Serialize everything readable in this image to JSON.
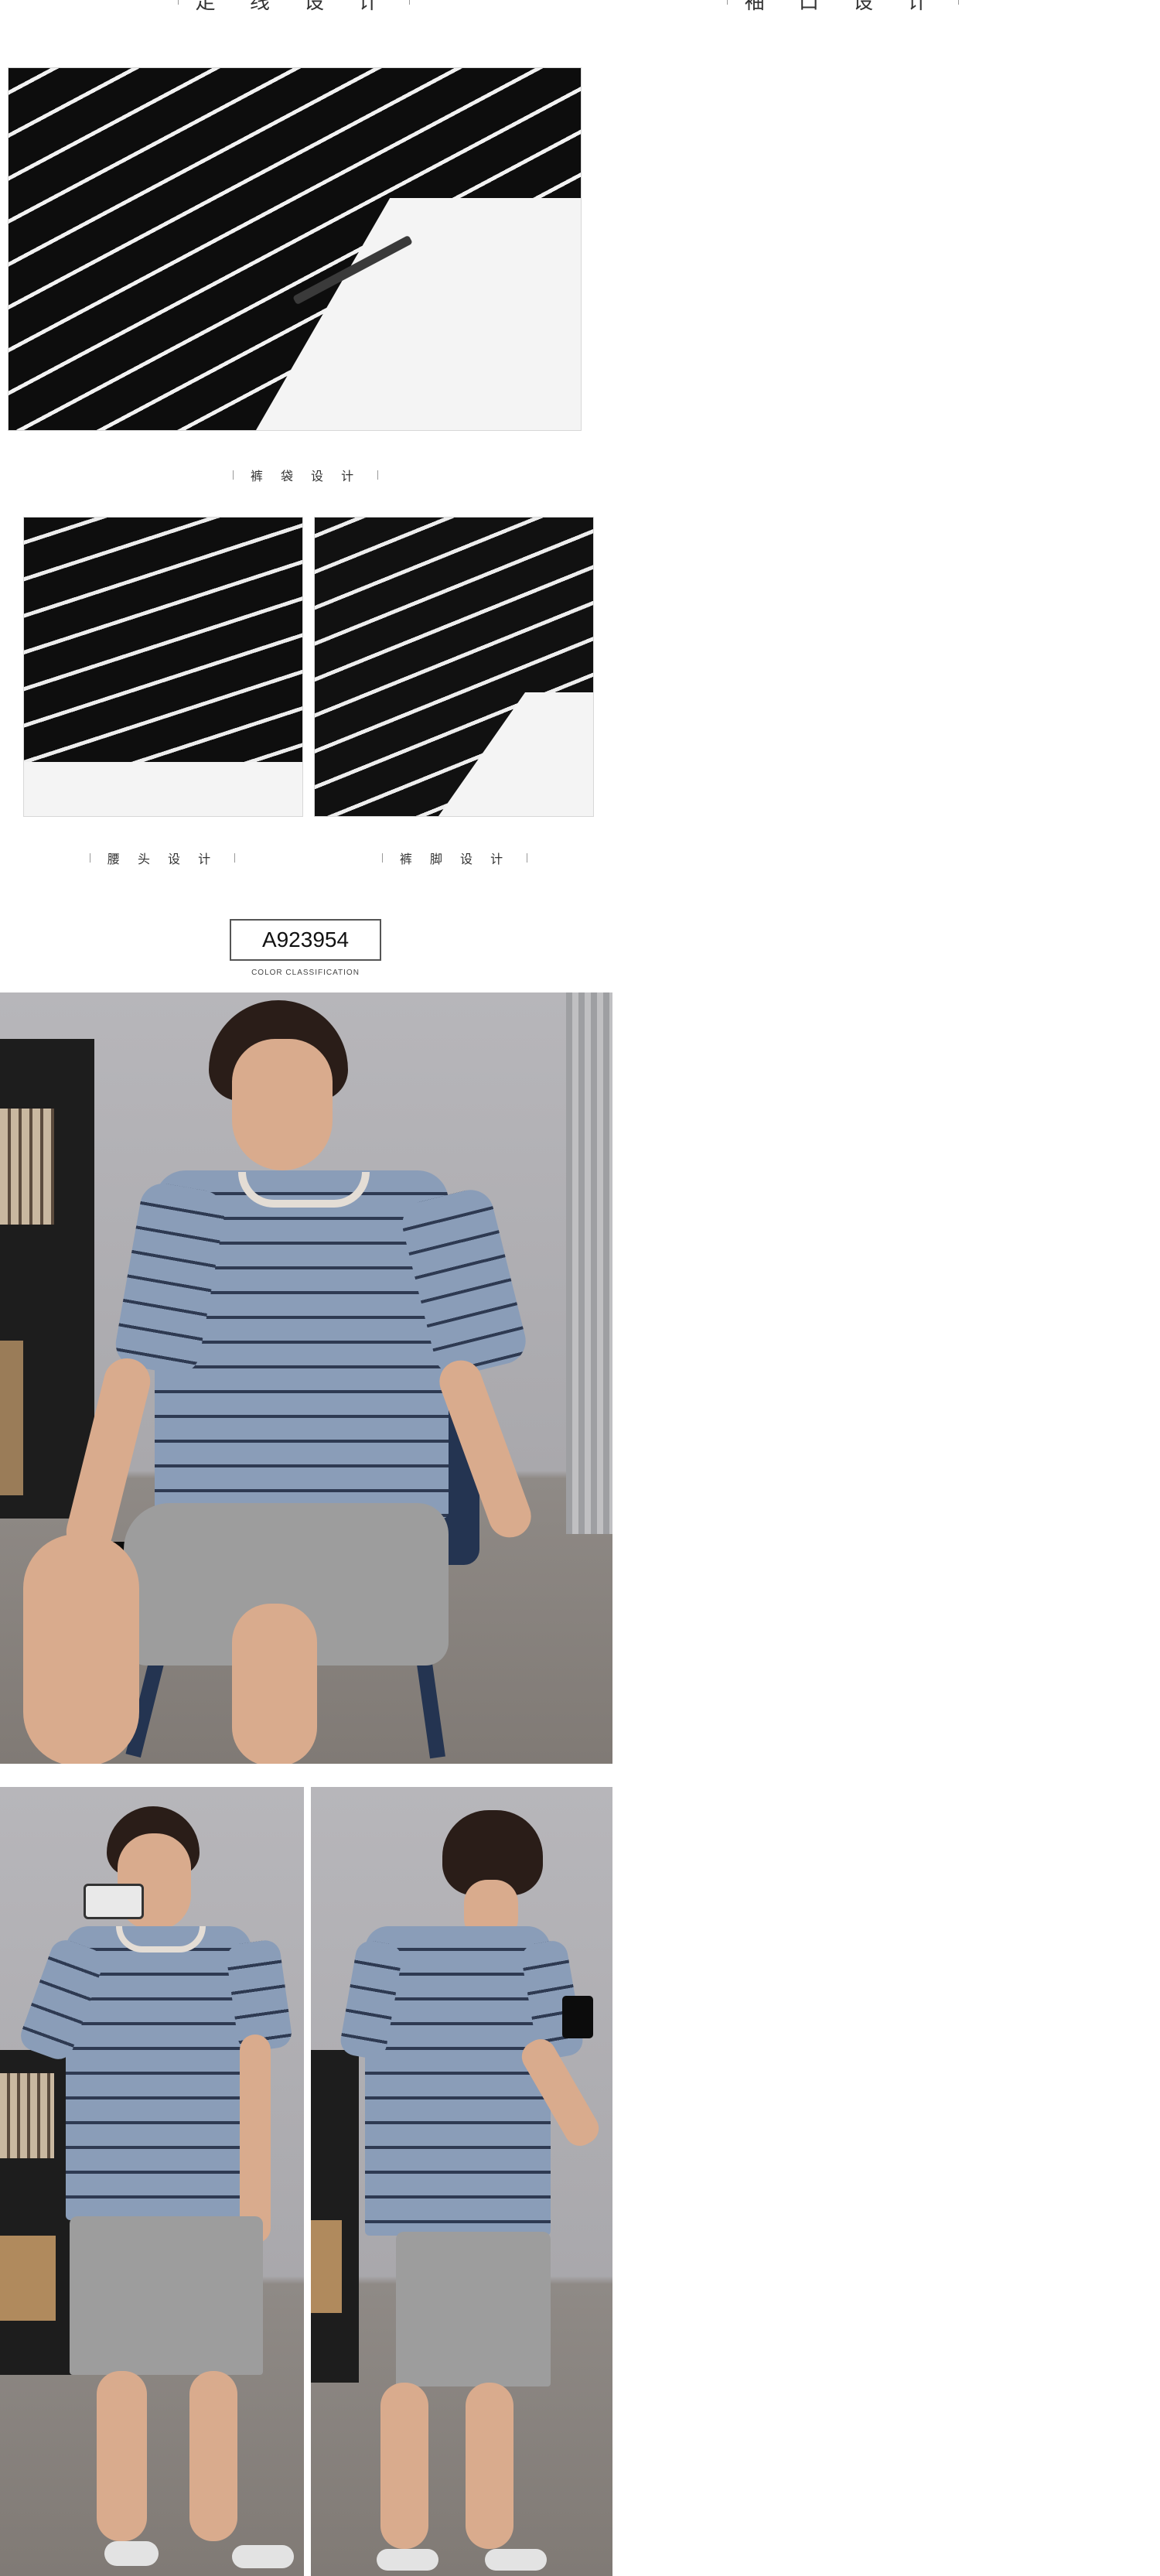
{
  "top_captions": {
    "left": "走 线 设 计",
    "right": "袖 口 设 计"
  },
  "pocket_caption": "裤 袋 设 计",
  "waist_caption": "腰 头 设 计",
  "hem_caption": "裤 脚 设 计",
  "model_code": "A923954",
  "color_classification": "COLOR CLASSIFICATION"
}
